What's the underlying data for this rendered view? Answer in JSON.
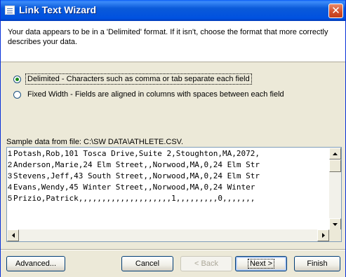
{
  "window": {
    "title": "Link Text Wizard",
    "close_glyph": "✕"
  },
  "header": {
    "description": "Your data appears to be in a 'Delimited' format. If it isn't, choose the format that more correctly describes your data."
  },
  "format_options": [
    {
      "label": "Delimited - Characters such as comma or tab separate each field",
      "selected": true
    },
    {
      "label": "Fixed Width - Fields are aligned in columns with spaces between each field",
      "selected": false
    }
  ],
  "sample": {
    "label": "Sample data from file: C:\\SW DATA\\ATHLETE.CSV.",
    "rows": [
      {
        "num": "1",
        "text": "Potash,Rob,101 Tosca Drive,Suite 2,Stoughton,MA,2072,"
      },
      {
        "num": "2",
        "text": "Anderson,Marie,24 Elm Street,,Norwood,MA,0,24 Elm Str"
      },
      {
        "num": "3",
        "text": "Stevens,Jeff,43 South Street,,Norwood,MA,0,24 Elm Str"
      },
      {
        "num": "4",
        "text": "Evans,Wendy,45 Winter Street,,Norwood,MA,0,24 Winter "
      },
      {
        "num": "5",
        "text": "Prizio,Patrick,,,,,,,,,,,,,,,,,,,,1,,,,,,,,,0,,,,,,,"
      },
      {
        "num": "",
        "text": ""
      },
      {
        "num": "",
        "text": ""
      }
    ]
  },
  "buttons": {
    "advanced": "Advanced...",
    "cancel": "Cancel",
    "back": "< Back",
    "next": "Next >",
    "finish": "Finish"
  },
  "icons": {
    "window": "wizard-window-icon",
    "close": "close-icon",
    "up": "arrow-up-icon",
    "down": "arrow-down-icon",
    "left": "arrow-left-icon",
    "right": "arrow-right-icon"
  }
}
